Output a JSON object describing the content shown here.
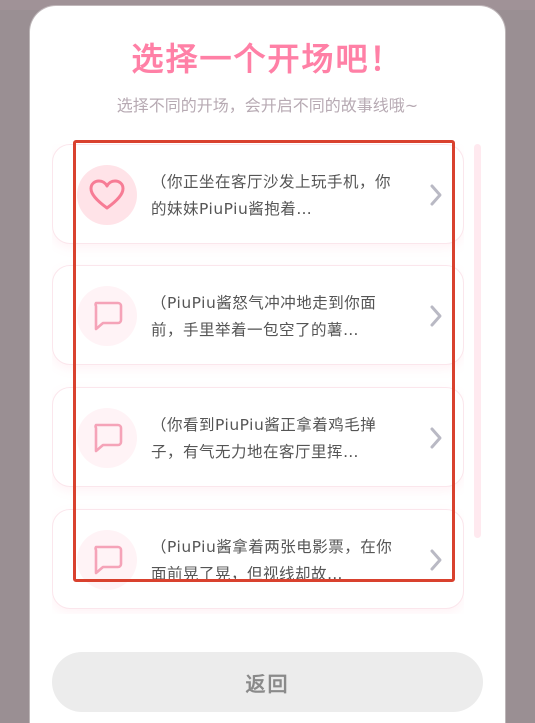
{
  "header": {
    "title": "选择一个开场吧！",
    "subtitle": "选择不同的开场，会开启不同的故事线哦~"
  },
  "openings": [
    {
      "icon": "heart-icon",
      "text": "（你正坐在客厅沙发上玩手机，你的妹妹PiuPiu酱抱着…"
    },
    {
      "icon": "chat-bubble-icon",
      "text": "（PiuPiu酱怒气冲冲地走到你面前，手里举着一包空了的薯…"
    },
    {
      "icon": "chat-bubble-icon",
      "text": "（你看到PiuPiu酱正拿着鸡毛掸子，有气无力地在客厅里挥…"
    },
    {
      "icon": "chat-bubble-icon",
      "text": "（PiuPiu酱拿着两张电影票，在你面前晃了晃，但视线却故…"
    }
  ],
  "footer": {
    "back_label": "返回"
  },
  "colors": {
    "accent": "#ff80a6",
    "subtitle": "#b7aab3",
    "highlight_box": "#d9412e",
    "chevron": "#b9b9c4"
  }
}
